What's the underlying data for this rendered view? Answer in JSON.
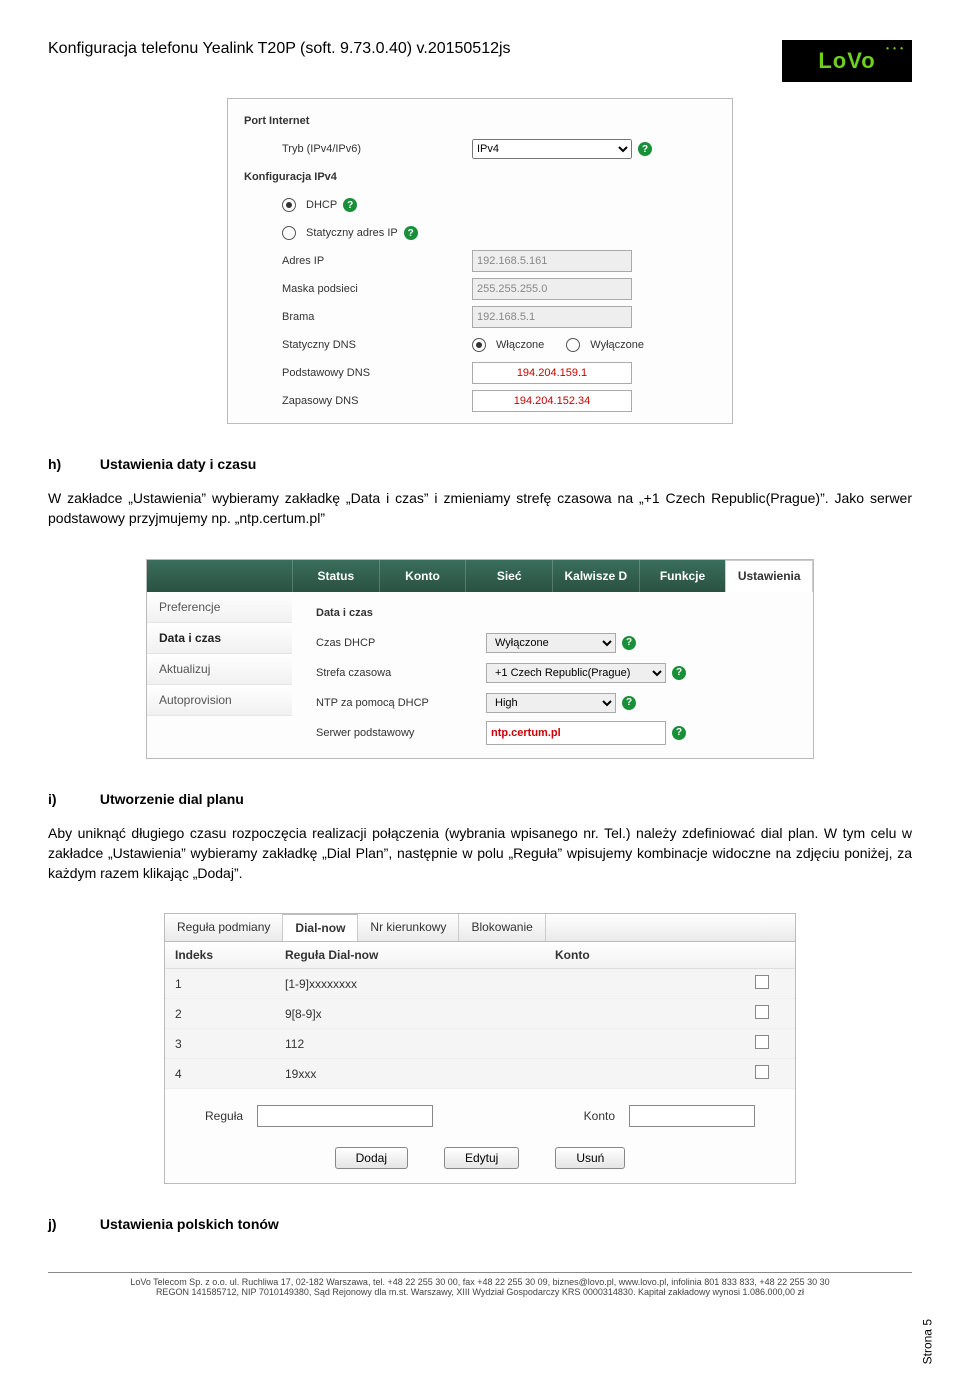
{
  "header": {
    "title": "Konfiguracja telefonu Yealink T20P (soft. 9.73.0.40) v.20150512js",
    "logo_text": "LoVo"
  },
  "fig1": {
    "port_section": "Port Internet",
    "tryb_label": "Tryb (IPv4/IPv6)",
    "tryb_value": "IPv4",
    "conf_ipv4": "Konfiguracja IPv4",
    "dhcp": "DHCP",
    "stat_ip": "Statyczny adres IP",
    "adres_ip_label": "Adres IP",
    "adres_ip_value": "192.168.5.161",
    "mask_label": "Maska podsieci",
    "mask_value": "255.255.255.0",
    "gateway_label": "Brama",
    "gateway_value": "192.168.5.1",
    "static_dns_label": "Statyczny DNS",
    "static_dns_on": "Włączone",
    "static_dns_off": "Wyłączone",
    "pdns_label": "Podstawowy DNS",
    "pdns_value": "194.204.159.1",
    "zdns_label": "Zapasowy DNS",
    "zdns_value": "194.204.152.34"
  },
  "section_h": {
    "letter": "h)",
    "heading": "Ustawienia daty i czasu",
    "p": "W zakładce „Ustawienia” wybieramy zakładkę „Data i czas” i zmieniamy strefę czasowa na „+1 Czech Republic(Prague)”. Jako serwer podstawowy przyjmujemy np. „ntp.certum.pl”"
  },
  "fig2": {
    "tabs": [
      "Status",
      "Konto",
      "Sieć",
      "Kalwisze D",
      "Funkcje",
      "Ustawienia"
    ],
    "sidebar": [
      "Preferencje",
      "Data i czas",
      "Aktualizuj",
      "Autoprovision"
    ],
    "content_title": "Data i czas",
    "rows": {
      "czas_dhcp_label": "Czas DHCP",
      "czas_dhcp_value": "Wyłączone",
      "tz_label": "Strefa czasowa",
      "tz_value": "+1 Czech Republic(Prague)",
      "ntp_dhcp_label": "NTP za pomocą DHCP",
      "ntp_dhcp_value": "High",
      "server_label": "Serwer podstawowy",
      "server_value": "ntp.certum.pl"
    }
  },
  "section_i": {
    "letter": "i)",
    "heading": "Utworzenie dial planu",
    "p": "Aby uniknąć długiego czasu rozpoczęcia realizacji połączenia (wybrania wpisanego nr. Tel.) należy zdefiniować dial plan. W tym celu w zakładce „Ustawienia” wybieramy zakładkę „Dial Plan”, następnie w polu „Reguła” wpisujemy kombinacje widoczne na zdjęciu poniżej, za każdym razem klikając „Dodaj”."
  },
  "fig3": {
    "tabs": [
      "Reguła podmiany",
      "Dial-now",
      "Nr kierunkowy",
      "Blokowanie"
    ],
    "columns": [
      "Indeks",
      "Reguła Dial-now",
      "Konto",
      ""
    ],
    "rows": [
      {
        "idx": "1",
        "rule": "[1-9]xxxxxxxx",
        "acct": ""
      },
      {
        "idx": "2",
        "rule": "9[8-9]x",
        "acct": ""
      },
      {
        "idx": "3",
        "rule": "112",
        "acct": ""
      },
      {
        "idx": "4",
        "rule": "19xxx",
        "acct": ""
      }
    ],
    "form": {
      "regula_label": "Reguła",
      "konto_label": "Konto"
    },
    "buttons": {
      "add": "Dodaj",
      "edit": "Edytuj",
      "del": "Usuń"
    }
  },
  "section_j": {
    "letter": "j)",
    "heading": "Ustawienia polskich tonów"
  },
  "page_side": "Strona 5",
  "footer": {
    "line1": "LoVo Telecom Sp. z o.o. ul. Ruchliwa 17, 02-182 Warszawa, tel. +48 22 255 30 00, fax +48 22 255 30 09, biznes@lovo.pl, www.lovo.pl, infolinia 801 833 833, +48 22 255 30 30",
    "line2": "REGON 141585712, NIP 7010149380, Sąd Rejonowy dla m.st. Warszawy, XIII Wydział Gospodarczy KRS 0000314830. Kapitał zakładowy wynosi 1.086.000,00 zł"
  }
}
